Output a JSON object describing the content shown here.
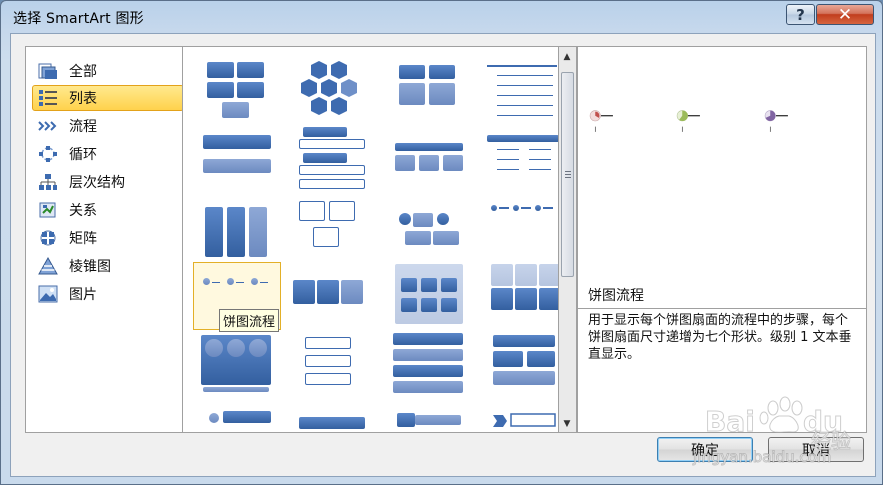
{
  "window": {
    "title": "选择 SmartArt 图形",
    "help_label": "?",
    "close_label": "✕"
  },
  "categories": [
    {
      "label": "全部",
      "icon": "all-icon",
      "selected": false
    },
    {
      "label": "列表",
      "icon": "list-icon",
      "selected": true
    },
    {
      "label": "流程",
      "icon": "process-icon",
      "selected": false
    },
    {
      "label": "循环",
      "icon": "cycle-icon",
      "selected": false
    },
    {
      "label": "层次结构",
      "icon": "hierarchy-icon",
      "selected": false
    },
    {
      "label": "关系",
      "icon": "relationship-icon",
      "selected": false
    },
    {
      "label": "矩阵",
      "icon": "matrix-icon",
      "selected": false
    },
    {
      "label": "棱锥图",
      "icon": "pyramid-icon",
      "selected": false
    },
    {
      "label": "图片",
      "icon": "picture-icon",
      "selected": false
    }
  ],
  "gallery": {
    "tooltip": "饼图流程",
    "selected_index": 8,
    "item_count": 24
  },
  "preview": {
    "name": "饼图流程",
    "description": "用于显示每个饼图扇面的流程中的步骤，每个饼图扇面尺寸递增为七个形状。级别 1 文本垂直显示。",
    "pie_colors": [
      "#c0504d",
      "#9bbb59",
      "#8064a2"
    ]
  },
  "buttons": {
    "ok": "确定",
    "cancel": "取消"
  },
  "watermark": {
    "brand": "Bai",
    "brand2": "du",
    "suffix": "经验",
    "url": "jingyan.baidu.com"
  },
  "colors": {
    "accent": "#3e6bb0",
    "selection": "#ffd24c"
  }
}
